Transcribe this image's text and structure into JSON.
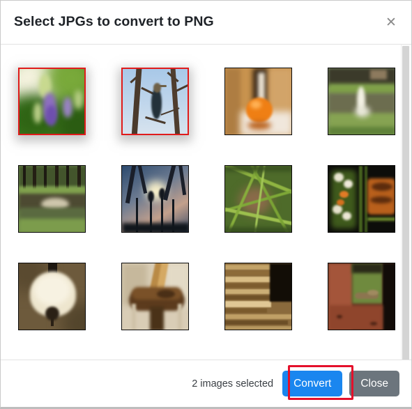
{
  "dialog": {
    "title": "Select JPGs to convert to PNG",
    "close_icon": "close-x-icon"
  },
  "gallery": {
    "rows": [
      [
        {
          "alt": "purple flower spike with green bokeh",
          "selected": true
        },
        {
          "alt": "cormorant bird perched on bare tree branches against blue sky",
          "selected": true
        },
        {
          "alt": "orange fruit on a reflective table in a warm hallway",
          "selected": false
        },
        {
          "alt": "water fountain in a pond with green grass banks",
          "selected": false
        }
      ],
      [
        {
          "alt": "flooded forest with bare trees and grass",
          "selected": false
        },
        {
          "alt": "sunset shining through silhouetted trees and reeds",
          "selected": false
        },
        {
          "alt": "close-up of green grass blades and dry leaves",
          "selected": false
        },
        {
          "alt": "plate of grilled salmon with roasted vegetables",
          "selected": false
        }
      ],
      [
        {
          "alt": "glowing pendant lamp shade hanging from ceiling",
          "selected": false
        },
        {
          "alt": "close-up of a wooden chair back and seat",
          "selected": false
        },
        {
          "alt": "stack of old books seen edge on",
          "selected": false
        },
        {
          "alt": "lizard on red brick wall by a doorway",
          "selected": false
        }
      ]
    ]
  },
  "footer": {
    "selected_count_text": "2 images selected",
    "convert_label": "Convert",
    "close_label": "Close"
  },
  "colors": {
    "accent_blue": "#1a86ef",
    "secondary_gray": "#6c757d",
    "selection_red": "#e01b1b",
    "annotation_red": "#e4102b"
  }
}
